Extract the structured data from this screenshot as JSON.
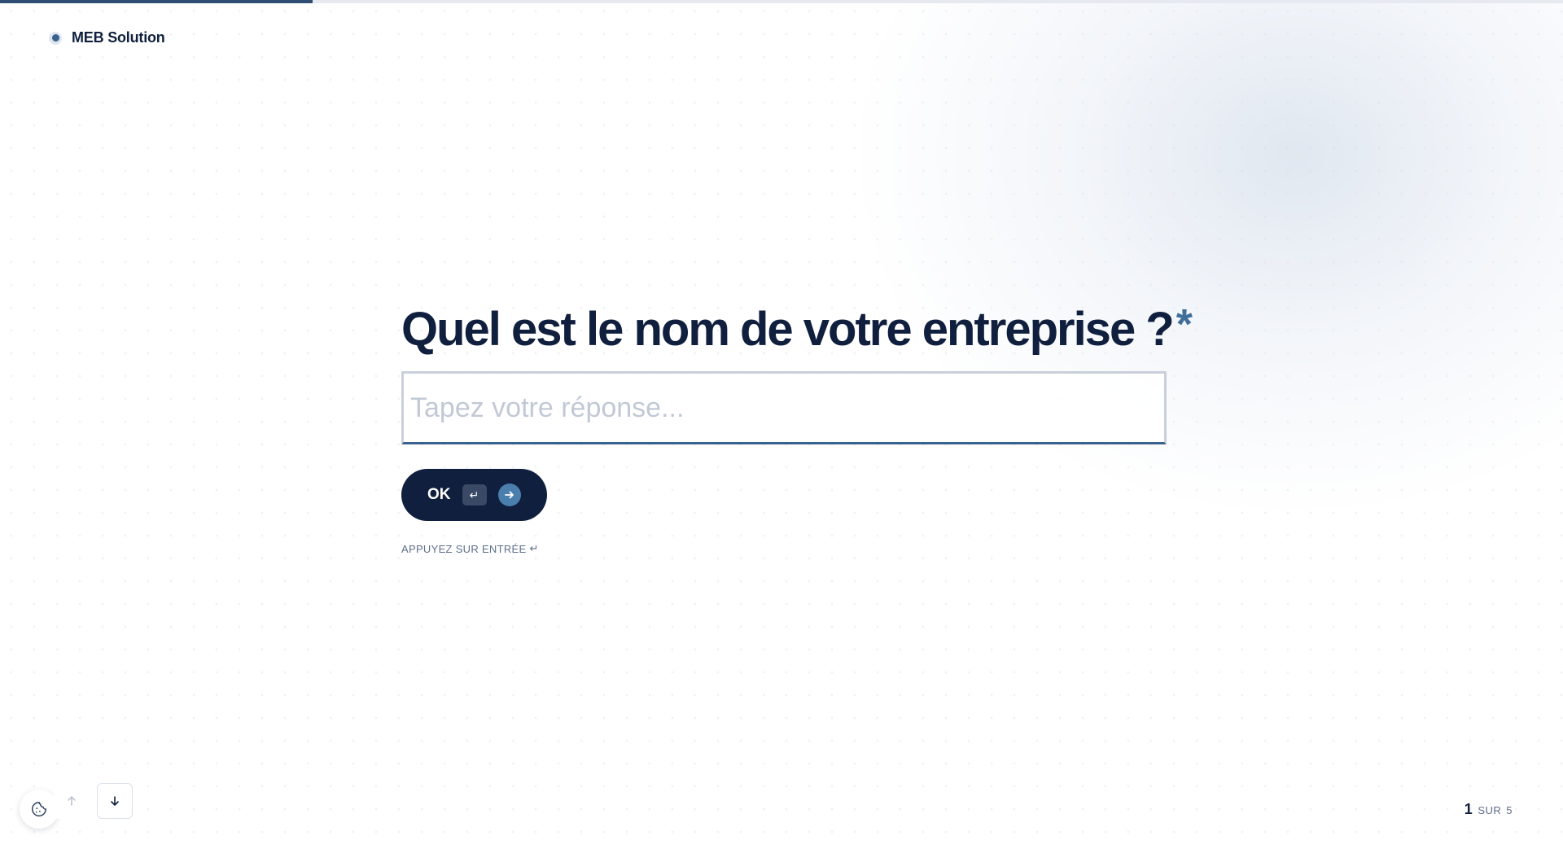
{
  "progress": {
    "fraction": 0.2,
    "accent_color": "#2e4e74"
  },
  "brand": {
    "name": "MEB Solution"
  },
  "question": {
    "text": "Quel est le nom de votre entreprise ?",
    "required_marker": "*"
  },
  "answer": {
    "value": "",
    "placeholder": "Tapez votre réponse..."
  },
  "ok_button": {
    "label": "OK",
    "enter_key_glyph": "↵",
    "icon": "arrow-right-icon"
  },
  "hint": {
    "text": "APPUYEZ SUR ENTRÉE",
    "glyph": "↵"
  },
  "navigation": {
    "up_icon": "arrow-up-icon",
    "down_icon": "arrow-down-icon",
    "cookie_icon": "cookie-icon"
  },
  "counter": {
    "current": "1",
    "separator": "SUR",
    "total": "5"
  },
  "colors": {
    "navy": "#0f1f3d",
    "accent": "#3f6f99",
    "muted": "#5d6f8a"
  }
}
